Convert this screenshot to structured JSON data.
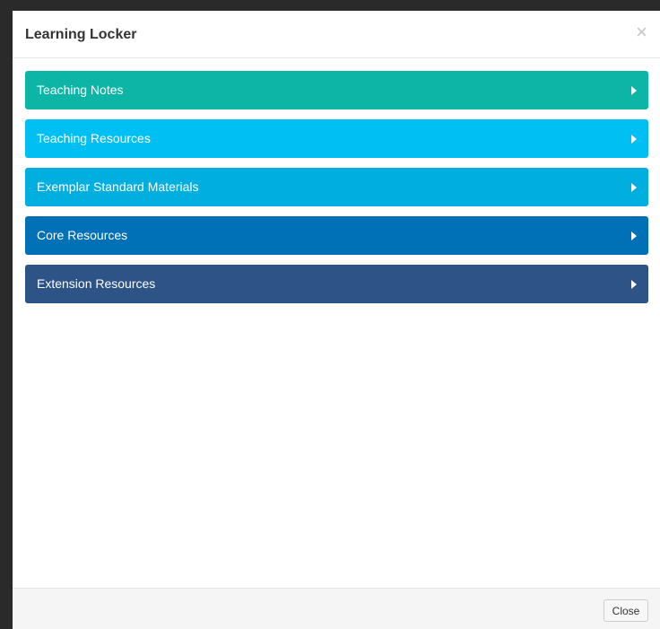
{
  "modal": {
    "title": "Learning Locker",
    "close_icon": "close-icon"
  },
  "items": [
    {
      "label": "Teaching Notes",
      "color": "#0db5a6"
    },
    {
      "label": "Teaching Resources",
      "color": "#00c0f3"
    },
    {
      "label": "Exemplar Standard Materials",
      "color": "#00aedf"
    },
    {
      "label": "Core Resources",
      "color": "#0070b7"
    },
    {
      "label": "Extension Resources",
      "color": "#2d5387"
    }
  ],
  "footer": {
    "close_label": "Close"
  }
}
